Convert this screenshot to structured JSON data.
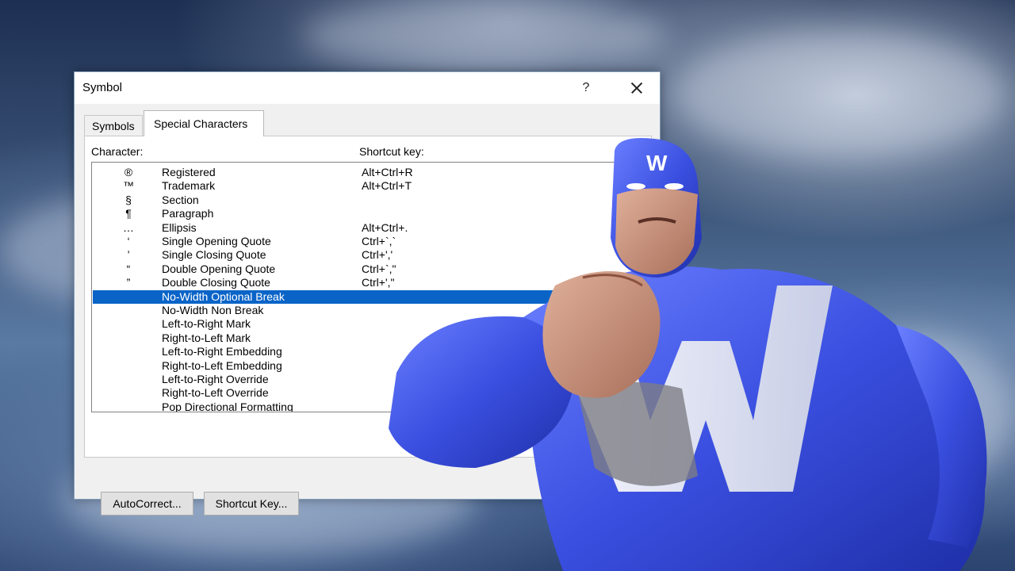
{
  "dialog": {
    "title": "Symbol",
    "help_label": "?",
    "tabs": [
      {
        "label": "Symbols"
      },
      {
        "label": "Special Characters"
      }
    ],
    "headers": {
      "character": "Character:",
      "shortcut": "Shortcut key:"
    },
    "rows": [
      {
        "symbol": "®",
        "name": "Registered",
        "shortcut": "Alt+Ctrl+R"
      },
      {
        "symbol": "™",
        "name": "Trademark",
        "shortcut": "Alt+Ctrl+T"
      },
      {
        "symbol": "§",
        "name": "Section",
        "shortcut": ""
      },
      {
        "symbol": "¶",
        "name": "Paragraph",
        "shortcut": ""
      },
      {
        "symbol": "…",
        "name": "Ellipsis",
        "shortcut": "Alt+Ctrl+."
      },
      {
        "symbol": "‘",
        "name": "Single Opening Quote",
        "shortcut": "Ctrl+`,`"
      },
      {
        "symbol": "’",
        "name": "Single Closing Quote",
        "shortcut": "Ctrl+','"
      },
      {
        "symbol": "“",
        "name": "Double Opening Quote",
        "shortcut": "Ctrl+`,\""
      },
      {
        "symbol": "”",
        "name": "Double Closing Quote",
        "shortcut": "Ctrl+',\""
      },
      {
        "symbol": "",
        "name": "No-Width Optional Break",
        "shortcut": ""
      },
      {
        "symbol": "",
        "name": "No-Width Non Break",
        "shortcut": ""
      },
      {
        "symbol": "",
        "name": "Left-to-Right Mark",
        "shortcut": ""
      },
      {
        "symbol": "",
        "name": "Right-to-Left Mark",
        "shortcut": ""
      },
      {
        "symbol": "",
        "name": "Left-to-Right Embedding",
        "shortcut": ""
      },
      {
        "symbol": "",
        "name": "Right-to-Left Embedding",
        "shortcut": ""
      },
      {
        "symbol": "",
        "name": "Left-to-Right Override",
        "shortcut": ""
      },
      {
        "symbol": "",
        "name": "Right-to-Left Override",
        "shortcut": ""
      },
      {
        "symbol": "",
        "name": "Pop Directional Formatting",
        "shortcut": ""
      }
    ],
    "selected_row": "No-Width Optional Break",
    "buttons": {
      "autocorrect": "AutoCorrect...",
      "shortcut_key": "Shortcut Key..."
    }
  },
  "mascot": {
    "chest_letter": "W",
    "head_letter": "W"
  },
  "colors": {
    "selection": "#0a64c8",
    "mascot_blue": "#3a4fe0"
  }
}
